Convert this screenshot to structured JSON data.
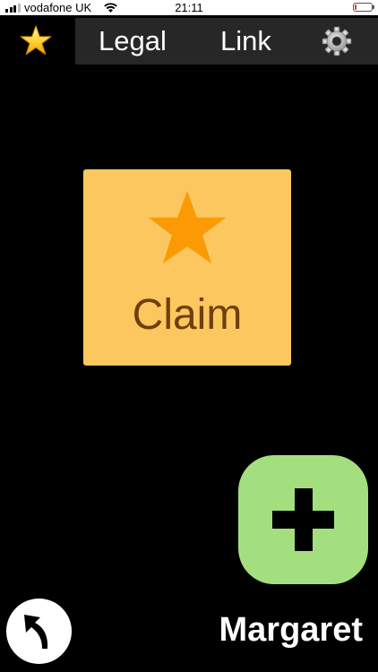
{
  "status_bar": {
    "carrier": "vodafone UK",
    "time": "21:11",
    "signal_bars": 3,
    "battery_level": 0.1,
    "battery_color": "#e23a2e",
    "icons": [
      "signal-icon",
      "wifi-icon",
      "battery-icon"
    ]
  },
  "top_bar": {
    "favorites_icon": "star-icon",
    "menu": {
      "legal_label": "Legal",
      "link_label": "Link",
      "settings_icon": "gear-icon"
    }
  },
  "main": {
    "claim_tile": {
      "label": "Claim",
      "icon": "star-icon",
      "background_color": "#fcc75e",
      "icon_color": "#fb9a04",
      "text_color": "#6f3f0b"
    },
    "add_button": {
      "icon": "plus-icon",
      "background_color": "#a3df7f"
    }
  },
  "footer": {
    "back_icon": "back-arrow-icon",
    "user_name": "Margaret"
  }
}
